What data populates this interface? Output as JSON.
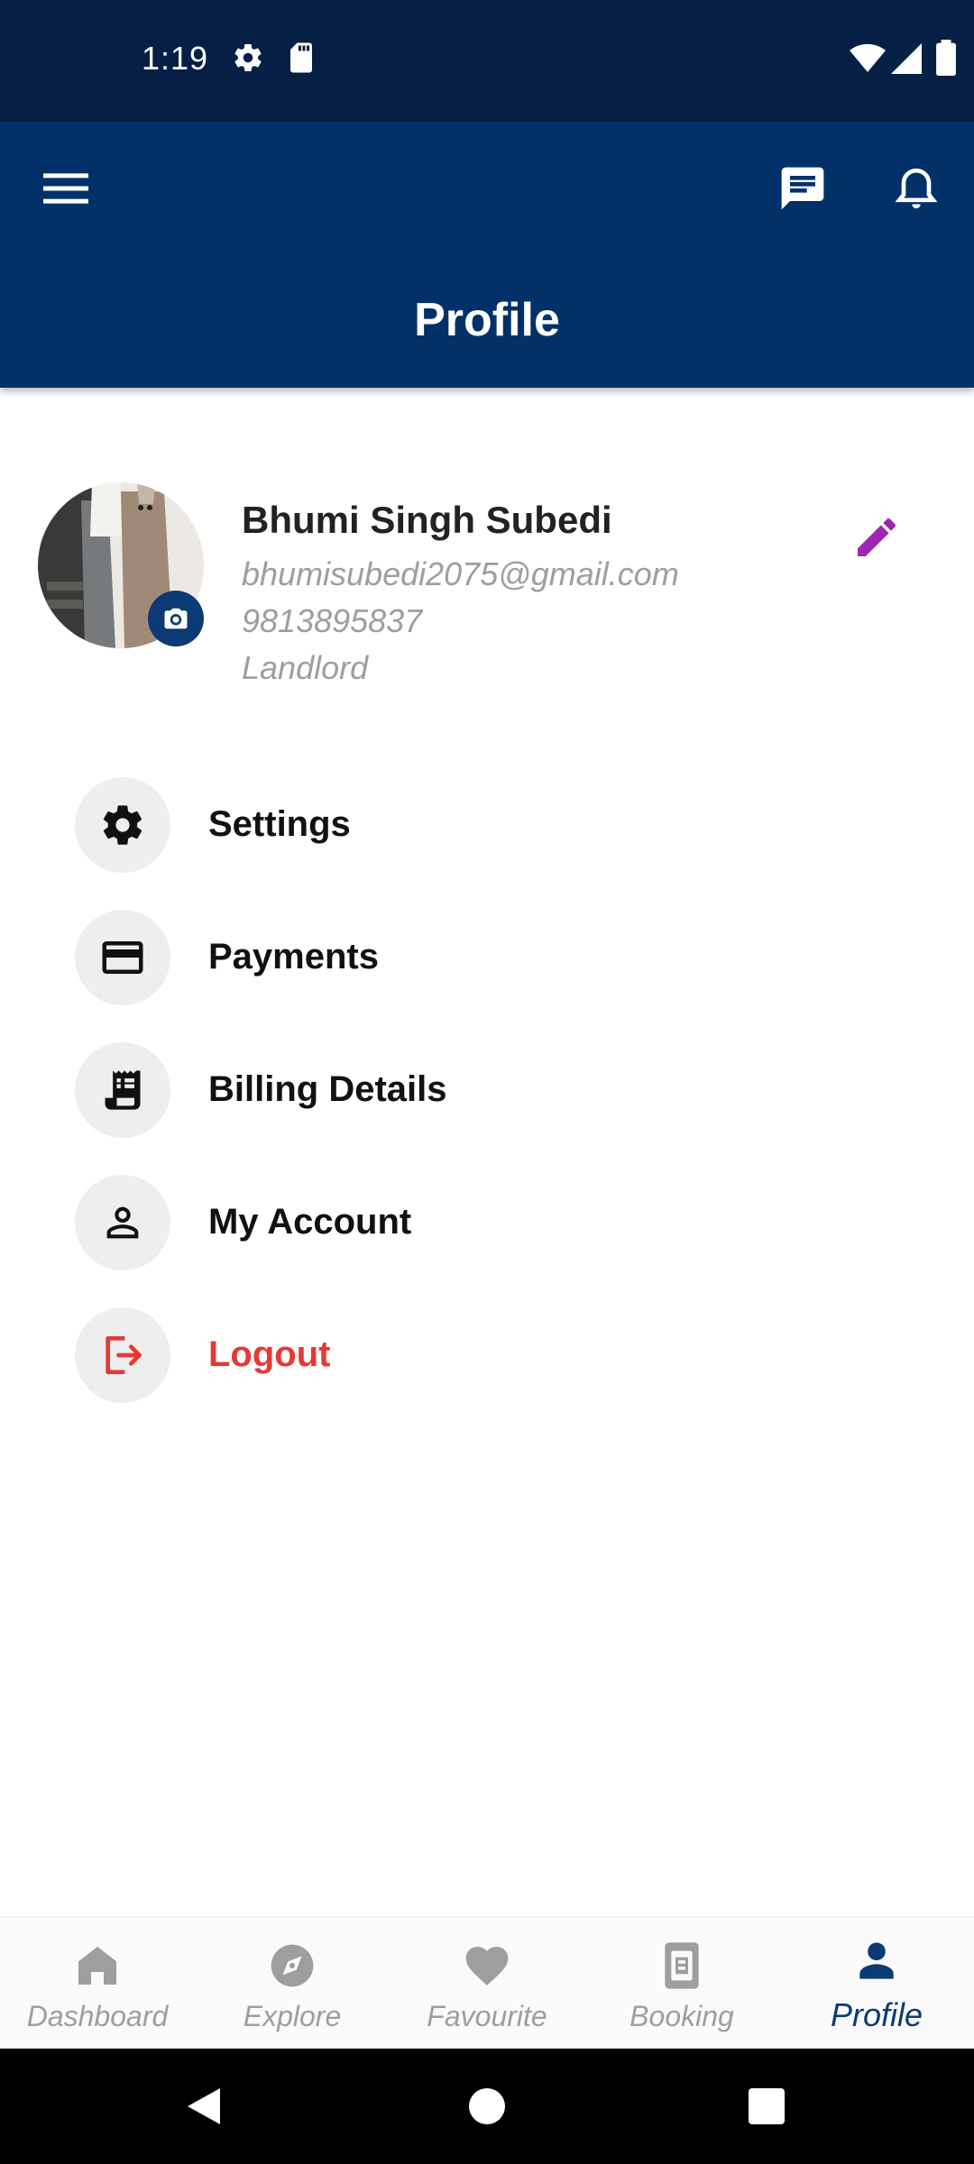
{
  "status_bar": {
    "time": "1:19",
    "icons": [
      "gear-icon",
      "sd-card-icon",
      "wifi-icon",
      "signal-icon",
      "battery-icon"
    ]
  },
  "app_bar": {
    "title": "Profile",
    "icons": [
      "menu-icon",
      "message-icon",
      "bell-icon"
    ],
    "background": "#02316a"
  },
  "profile": {
    "name": "Bhumi Singh Subedi",
    "email": "bhumisubedi2075@gmail.com",
    "phone": "9813895837",
    "role": "Landlord",
    "edit_icon_color": "#9c27b0"
  },
  "menu": {
    "items": [
      {
        "label": "Settings",
        "icon": "gear-icon"
      },
      {
        "label": "Payments",
        "icon": "credit-card-icon"
      },
      {
        "label": "Billing Details",
        "icon": "receipt-icon"
      },
      {
        "label": "My Account",
        "icon": "person-icon"
      },
      {
        "label": "Logout",
        "icon": "logout-icon",
        "color": "#e53935"
      }
    ]
  },
  "bottom_nav": {
    "items": [
      {
        "label": "Dashboard",
        "icon": "home-icon"
      },
      {
        "label": "Explore",
        "icon": "compass-icon"
      },
      {
        "label": "Favourite",
        "icon": "heart-icon"
      },
      {
        "label": "Booking",
        "icon": "booking-icon"
      },
      {
        "label": "Profile",
        "icon": "person-icon",
        "active": true
      }
    ],
    "active_color": "#0b3a75",
    "inactive_color": "#9e9e9e"
  }
}
